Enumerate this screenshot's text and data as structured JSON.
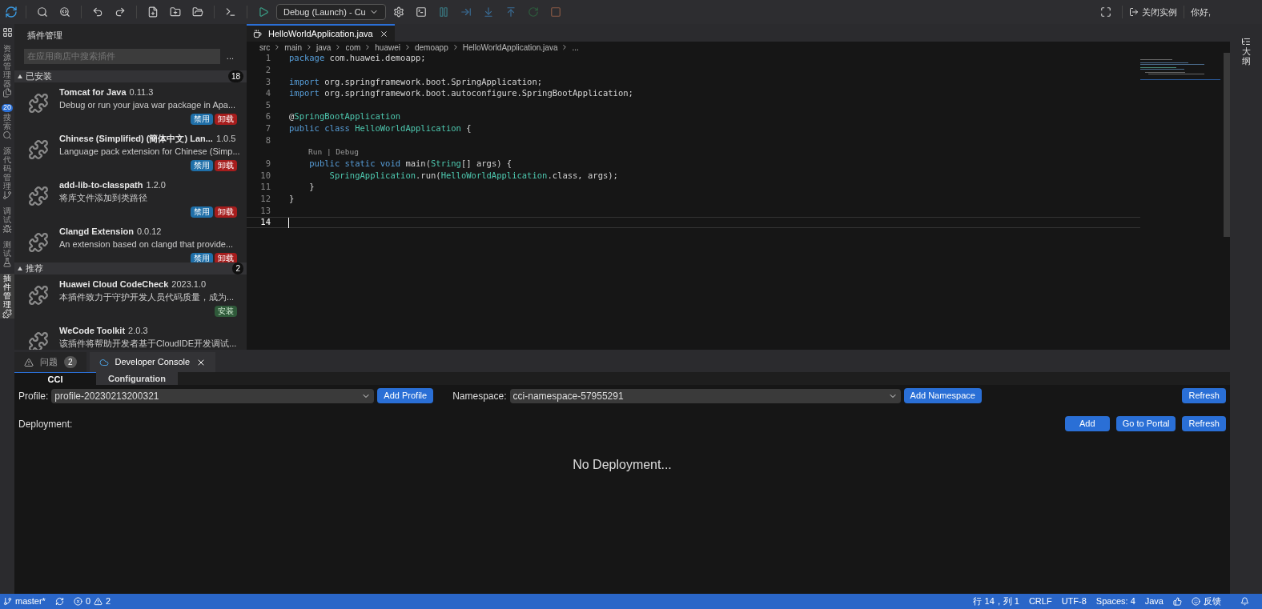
{
  "toolbar": {
    "debug_config": "Debug (Launch) - Cu",
    "close_instance": "关闭实例",
    "greeting": "你好,"
  },
  "activity_bar": [
    {
      "label": "资源管理器",
      "selected": false
    },
    {
      "label": "搜索",
      "selected": false,
      "badge": "20"
    },
    {
      "label": "源代码管理",
      "selected": false
    },
    {
      "label": "调试",
      "selected": false
    },
    {
      "label": "测试",
      "selected": false
    },
    {
      "label": "插件管理",
      "selected": true
    }
  ],
  "sidebar": {
    "title": "插件管理",
    "search": {
      "placeholder": "在应用商店中搜索插件"
    },
    "more": "...",
    "sections": [
      {
        "title": "已安装",
        "count": "18",
        "items": [
          {
            "name": "Tomcat for Java",
            "version": "0.11.3",
            "description": "Debug or run your java war package in Apa...",
            "actions": [
              {
                "label": "禁用",
                "kind": "disable"
              },
              {
                "label": "卸载",
                "kind": "uninstall"
              }
            ]
          },
          {
            "name": "Chinese (Simplified) (簡体中文) Lan...",
            "version": "1.0.5",
            "description": "Language pack extension for Chinese (Simp...",
            "actions": [
              {
                "label": "禁用",
                "kind": "disable"
              },
              {
                "label": "卸载",
                "kind": "uninstall"
              }
            ]
          },
          {
            "name": "add-lib-to-classpath",
            "version": "1.2.0",
            "description": "将库文件添加到类路径",
            "actions": [
              {
                "label": "禁用",
                "kind": "disable"
              },
              {
                "label": "卸载",
                "kind": "uninstall"
              }
            ]
          },
          {
            "name": "Clangd Extension",
            "version": "0.0.12",
            "description": "An extension based on clangd that provide...",
            "actions": [
              {
                "label": "禁用",
                "kind": "disable"
              },
              {
                "label": "卸载",
                "kind": "uninstall"
              }
            ]
          }
        ]
      },
      {
        "title": "推荐",
        "count": "2",
        "items": [
          {
            "name": "Huawei Cloud CodeCheck",
            "version": "2023.1.0",
            "description": "本插件致力于守护开发人员代码质量，成为...",
            "actions": [
              {
                "label": "安装",
                "kind": "install"
              }
            ]
          },
          {
            "name": "WeCode Toolkit",
            "version": "2.0.3",
            "description": "该插件将帮助开发者基于CloudIDE开发调试..."
          }
        ]
      }
    ]
  },
  "editor": {
    "tab": {
      "label": "HelloWorldApplication.java",
      "selected": true
    },
    "breadcrumbs": [
      "src",
      "main",
      "java",
      "com",
      "huawei",
      "demoapp",
      "HelloWorldApplication.java",
      "..."
    ],
    "lines": [
      {
        "kind": "code",
        "number": "1",
        "current": false,
        "tokens": [
          {
            "text": "package",
            "kind": "keyword"
          },
          {
            "text": " com.huawei.demoapp;",
            "kind": "plain"
          }
        ]
      },
      {
        "kind": "code",
        "number": "2",
        "current": false
      },
      {
        "kind": "code",
        "number": "3",
        "current": false,
        "tokens": [
          {
            "text": "import",
            "kind": "keyword"
          },
          {
            "text": " org.springframework.boot.SpringApplication;",
            "kind": "plain"
          }
        ]
      },
      {
        "kind": "code",
        "number": "4",
        "current": false,
        "tokens": [
          {
            "text": "import",
            "kind": "keyword"
          },
          {
            "text": " org.springframework.boot.autoconfigure.SpringBootApplication;",
            "kind": "plain"
          }
        ]
      },
      {
        "kind": "code",
        "number": "5",
        "current": false
      },
      {
        "kind": "code",
        "number": "6",
        "current": false,
        "tokens": [
          {
            "text": "@",
            "kind": "plain"
          },
          {
            "text": "SpringBootApplication",
            "kind": "type"
          }
        ]
      },
      {
        "kind": "code",
        "number": "7",
        "current": false,
        "tokens": [
          {
            "text": "public class ",
            "kind": "keyword"
          },
          {
            "text": "HelloWorldApplication",
            "kind": "type"
          },
          {
            "text": " {",
            "kind": "plain"
          }
        ]
      },
      {
        "kind": "code",
        "number": "8",
        "current": false
      },
      {
        "kind": "codelens",
        "text": "Run | Debug"
      },
      {
        "kind": "code",
        "number": "9",
        "current": false,
        "tokens": [
          {
            "text": "    public static void",
            "kind": "keyword"
          },
          {
            "text": " main(",
            "kind": "plain"
          },
          {
            "text": "String",
            "kind": "type"
          },
          {
            "text": "[] args) {",
            "kind": "plain"
          }
        ]
      },
      {
        "kind": "code",
        "number": "10",
        "current": false,
        "tokens": [
          {
            "text": "        SpringApplication",
            "kind": "type"
          },
          {
            "text": ".run(",
            "kind": "plain"
          },
          {
            "text": "HelloWorldApplication",
            "kind": "type"
          },
          {
            "text": ".class, args);",
            "kind": "plain"
          }
        ]
      },
      {
        "kind": "code",
        "number": "11",
        "current": false,
        "tokens": [
          {
            "text": "    }",
            "kind": "plain"
          }
        ]
      },
      {
        "kind": "code",
        "number": "12",
        "current": false,
        "tokens": [
          {
            "text": "}",
            "kind": "plain"
          }
        ]
      },
      {
        "kind": "code",
        "number": "13",
        "current": false
      },
      {
        "kind": "code",
        "number": "14",
        "current": true
      }
    ]
  },
  "outline_bar": {
    "label": "大纲"
  },
  "panel": {
    "tabs": [
      {
        "label": "问题",
        "count": "2",
        "selected": false
      },
      {
        "label": "Developer Console",
        "selected": true
      }
    ],
    "subtabs": [
      {
        "label": "CCI",
        "selected": true
      },
      {
        "label": "Configuration",
        "selected": false
      }
    ],
    "profile": {
      "label": "Profile:",
      "value": "profile-20230213200321",
      "button": "Add Profile"
    },
    "namespace": {
      "label": "Namespace:",
      "value": "cci-namespace-57955291",
      "button": "Add Namespace"
    },
    "refresh_top": "Refresh",
    "deployment": {
      "label": "Deployment:",
      "buttons": [
        "Add",
        "Go to Portal",
        "Refresh"
      ],
      "empty": "No Deployment..."
    }
  },
  "status_bar": {
    "branch": "master*",
    "errors": "0",
    "warnings": "2",
    "position": "行 14，列 1",
    "eol": "CRLF",
    "encoding": "UTF-8",
    "indent": "Spaces: 4",
    "language": "Java",
    "feedback": "反馈"
  }
}
